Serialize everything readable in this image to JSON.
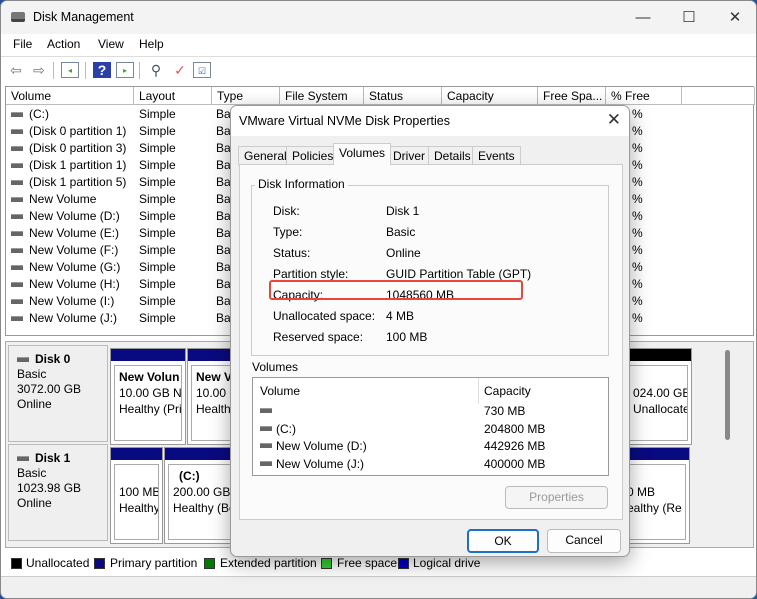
{
  "window": {
    "title": "Disk Management",
    "minimize": "—",
    "maximize": "☐",
    "close": "✕"
  },
  "menu": [
    "File",
    "Action",
    "View",
    "Help"
  ],
  "toolbar": [
    "back-icon",
    "forward-icon",
    "show-hide-console-tree-icon",
    "help-icon",
    "show-hide-action-pane-icon",
    "connect-disk-icon",
    "properties-icon",
    "checklist-icon"
  ],
  "list": {
    "columns": [
      "Volume",
      "Layout",
      "Type",
      "File System",
      "Status",
      "Capacity",
      "Free Spa...",
      "% Free"
    ],
    "rows": [
      [
        "(C:)",
        "Simple",
        "Ba",
        "%"
      ],
      [
        "(Disk 0 partition 1)",
        "Simple",
        "Ba",
        "%"
      ],
      [
        "(Disk 0 partition 3)",
        "Simple",
        "Ba",
        "%"
      ],
      [
        "(Disk 1 partition 1)",
        "Simple",
        "Ba",
        "%"
      ],
      [
        "(Disk 1 partition 5)",
        "Simple",
        "Ba",
        "%"
      ],
      [
        "New Volume",
        "Simple",
        "Ba",
        "%"
      ],
      [
        "New Volume (D:)",
        "Simple",
        "Ba",
        "%"
      ],
      [
        "New Volume (E:)",
        "Simple",
        "Ba",
        "%"
      ],
      [
        "New Volume (F:)",
        "Simple",
        "Ba",
        "%"
      ],
      [
        "New Volume (G:)",
        "Simple",
        "Ba",
        "%"
      ],
      [
        "New Volume (H:)",
        "Simple",
        "Ba",
        "%"
      ],
      [
        "New Volume (I:)",
        "Simple",
        "Ba",
        "%"
      ],
      [
        "New Volume (J:)",
        "Simple",
        "Ba",
        "%"
      ]
    ]
  },
  "disks": [
    {
      "name": "Disk 0",
      "type": "Basic",
      "size": "3072.00 GB",
      "status": "Online",
      "parts": [
        {
          "title": "New Volun",
          "l1": "10.00 GB NT",
          "l2": "Healthy (Pri"
        },
        {
          "title": "New V",
          "l1": "10.00 G",
          "l2": "Healthy"
        },
        {
          "title": "",
          "l1": "024.00 GB",
          "l2": "Unallocated"
        }
      ]
    },
    {
      "name": "Disk 1",
      "type": "Basic",
      "size": "1023.98 GB",
      "status": "Online",
      "parts": [
        {
          "title": "",
          "l1": "100 MB",
          "l2": "Healthy"
        },
        {
          "title": "(C:)",
          "l1": "200.00 GB N",
          "l2": "Healthy (Bo"
        },
        {
          "title": "",
          "l1": "0 MB",
          "l2": "ealthy (Re"
        }
      ]
    }
  ],
  "legend": [
    {
      "label": "Unallocated",
      "color": "#000000"
    },
    {
      "label": "Primary partition",
      "color": "#0a0a80"
    },
    {
      "label": "Extended partition",
      "color": "#007a00"
    },
    {
      "label": "Free space",
      "color": "#33cc33"
    },
    {
      "label": "Logical drive",
      "color": "#0000cc"
    }
  ],
  "dialog": {
    "title": "VMware Virtual NVMe Disk Properties",
    "close": "✕",
    "tabs": [
      "General",
      "Policies",
      "Volumes",
      "Driver",
      "Details",
      "Events"
    ],
    "active_tab": "Volumes",
    "group_title": "Disk Information",
    "info": [
      [
        "Disk:",
        "Disk 1"
      ],
      [
        "Type:",
        "Basic"
      ],
      [
        "Status:",
        "Online"
      ],
      [
        "Partition style:",
        "GUID Partition Table (GPT)"
      ],
      [
        "Capacity:",
        "1048560 MB"
      ],
      [
        "Unallocated space:",
        "4 MB"
      ],
      [
        "Reserved space:",
        "100 MB"
      ]
    ],
    "volumes_label": "Volumes",
    "vol_columns": [
      "Volume",
      "Capacity"
    ],
    "volumes": [
      [
        "",
        "730 MB"
      ],
      [
        "(C:)",
        "204800 MB"
      ],
      [
        "New Volume (D:)",
        "442926 MB"
      ],
      [
        "New Volume (J:)",
        "400000 MB"
      ]
    ],
    "properties": "Properties",
    "ok": "OK",
    "cancel": "Cancel"
  }
}
